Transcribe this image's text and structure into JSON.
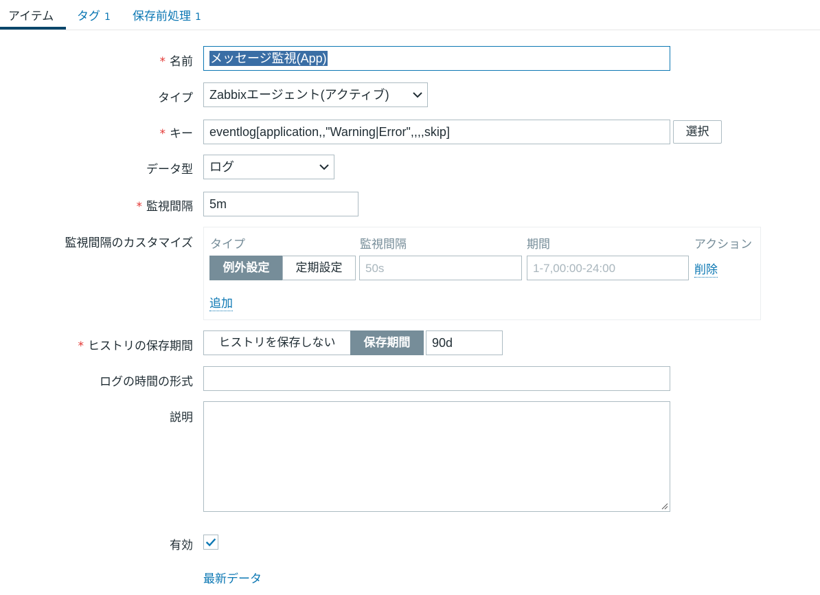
{
  "tabs": [
    {
      "label": "アイテム",
      "count": ""
    },
    {
      "label": "タグ",
      "count": "1"
    },
    {
      "label": "保存前処理",
      "count": "1"
    }
  ],
  "required_mark": "*",
  "form": {
    "name": {
      "label": "名前",
      "value": "メッセージ監視(App)",
      "required": true
    },
    "type": {
      "label": "タイプ",
      "value": "Zabbixエージェント(アクティブ)"
    },
    "key": {
      "label": "キー",
      "value": "eventlog[application,,\"Warning|Error\",,,,skip]",
      "button": "選択",
      "required": true
    },
    "data_type": {
      "label": "データ型",
      "value": "ログ"
    },
    "interval": {
      "label": "監視間隔",
      "value": "5m",
      "required": true
    },
    "custom_intervals": {
      "label": "監視間隔のカスタマイズ",
      "columns": [
        "タイプ",
        "監視間隔",
        "期間",
        "アクション"
      ],
      "row": {
        "type_options": [
          "例外設定",
          "定期設定"
        ],
        "type_selected": "例外設定",
        "interval_placeholder": "50s",
        "period_placeholder": "1-7,00:00-24:00",
        "action": "削除"
      },
      "add": "追加"
    },
    "history": {
      "label": "ヒストリの保存期間",
      "options": [
        "ヒストリを保存しない",
        "保存期間"
      ],
      "selected": "保存期間",
      "value": "90d",
      "required": true
    },
    "log_time_format": {
      "label": "ログの時間の形式",
      "value": ""
    },
    "description": {
      "label": "説明",
      "value": ""
    },
    "enabled": {
      "label": "有効",
      "checked": true
    }
  },
  "latest_data_link": "最新データ",
  "colors": {
    "accent": "#0b77b3",
    "active_tab": "#0a466a",
    "segment_on": "#768d99",
    "required": "#e33734"
  }
}
